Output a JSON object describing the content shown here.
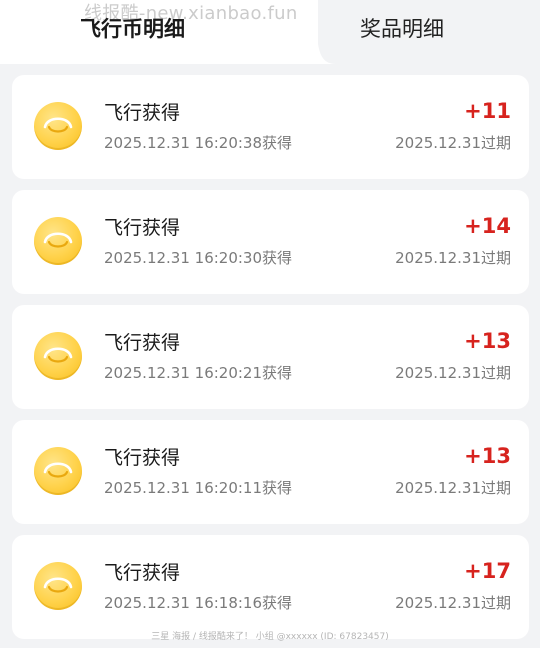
{
  "tabs": [
    {
      "label": "飞行币明细",
      "active": true
    },
    {
      "label": "奖品明细",
      "active": false
    }
  ],
  "watermark": "线报酷-new.xianbao.fun",
  "records": [
    {
      "title": "飞行获得",
      "time": "2025.12.31 16:20:38获得",
      "amount": "+11",
      "expire": "2025.12.31过期"
    },
    {
      "title": "飞行获得",
      "time": "2025.12.31 16:20:30获得",
      "amount": "+14",
      "expire": "2025.12.31过期"
    },
    {
      "title": "飞行获得",
      "time": "2025.12.31 16:20:21获得",
      "amount": "+13",
      "expire": "2025.12.31过期"
    },
    {
      "title": "飞行获得",
      "time": "2025.12.31 16:20:11获得",
      "amount": "+13",
      "expire": "2025.12.31过期"
    },
    {
      "title": "飞行获得",
      "time": "2025.12.31 16:18:16获得",
      "amount": "+17",
      "expire": "2025.12.31过期"
    }
  ],
  "footer_note": "三星 海报 / 线报酷来了！ 小组 @xxxxxx (ID: 67823457)",
  "colors": {
    "amount": "#d7231e",
    "coin": "#ffd24a",
    "background": "#f2f3f5"
  }
}
